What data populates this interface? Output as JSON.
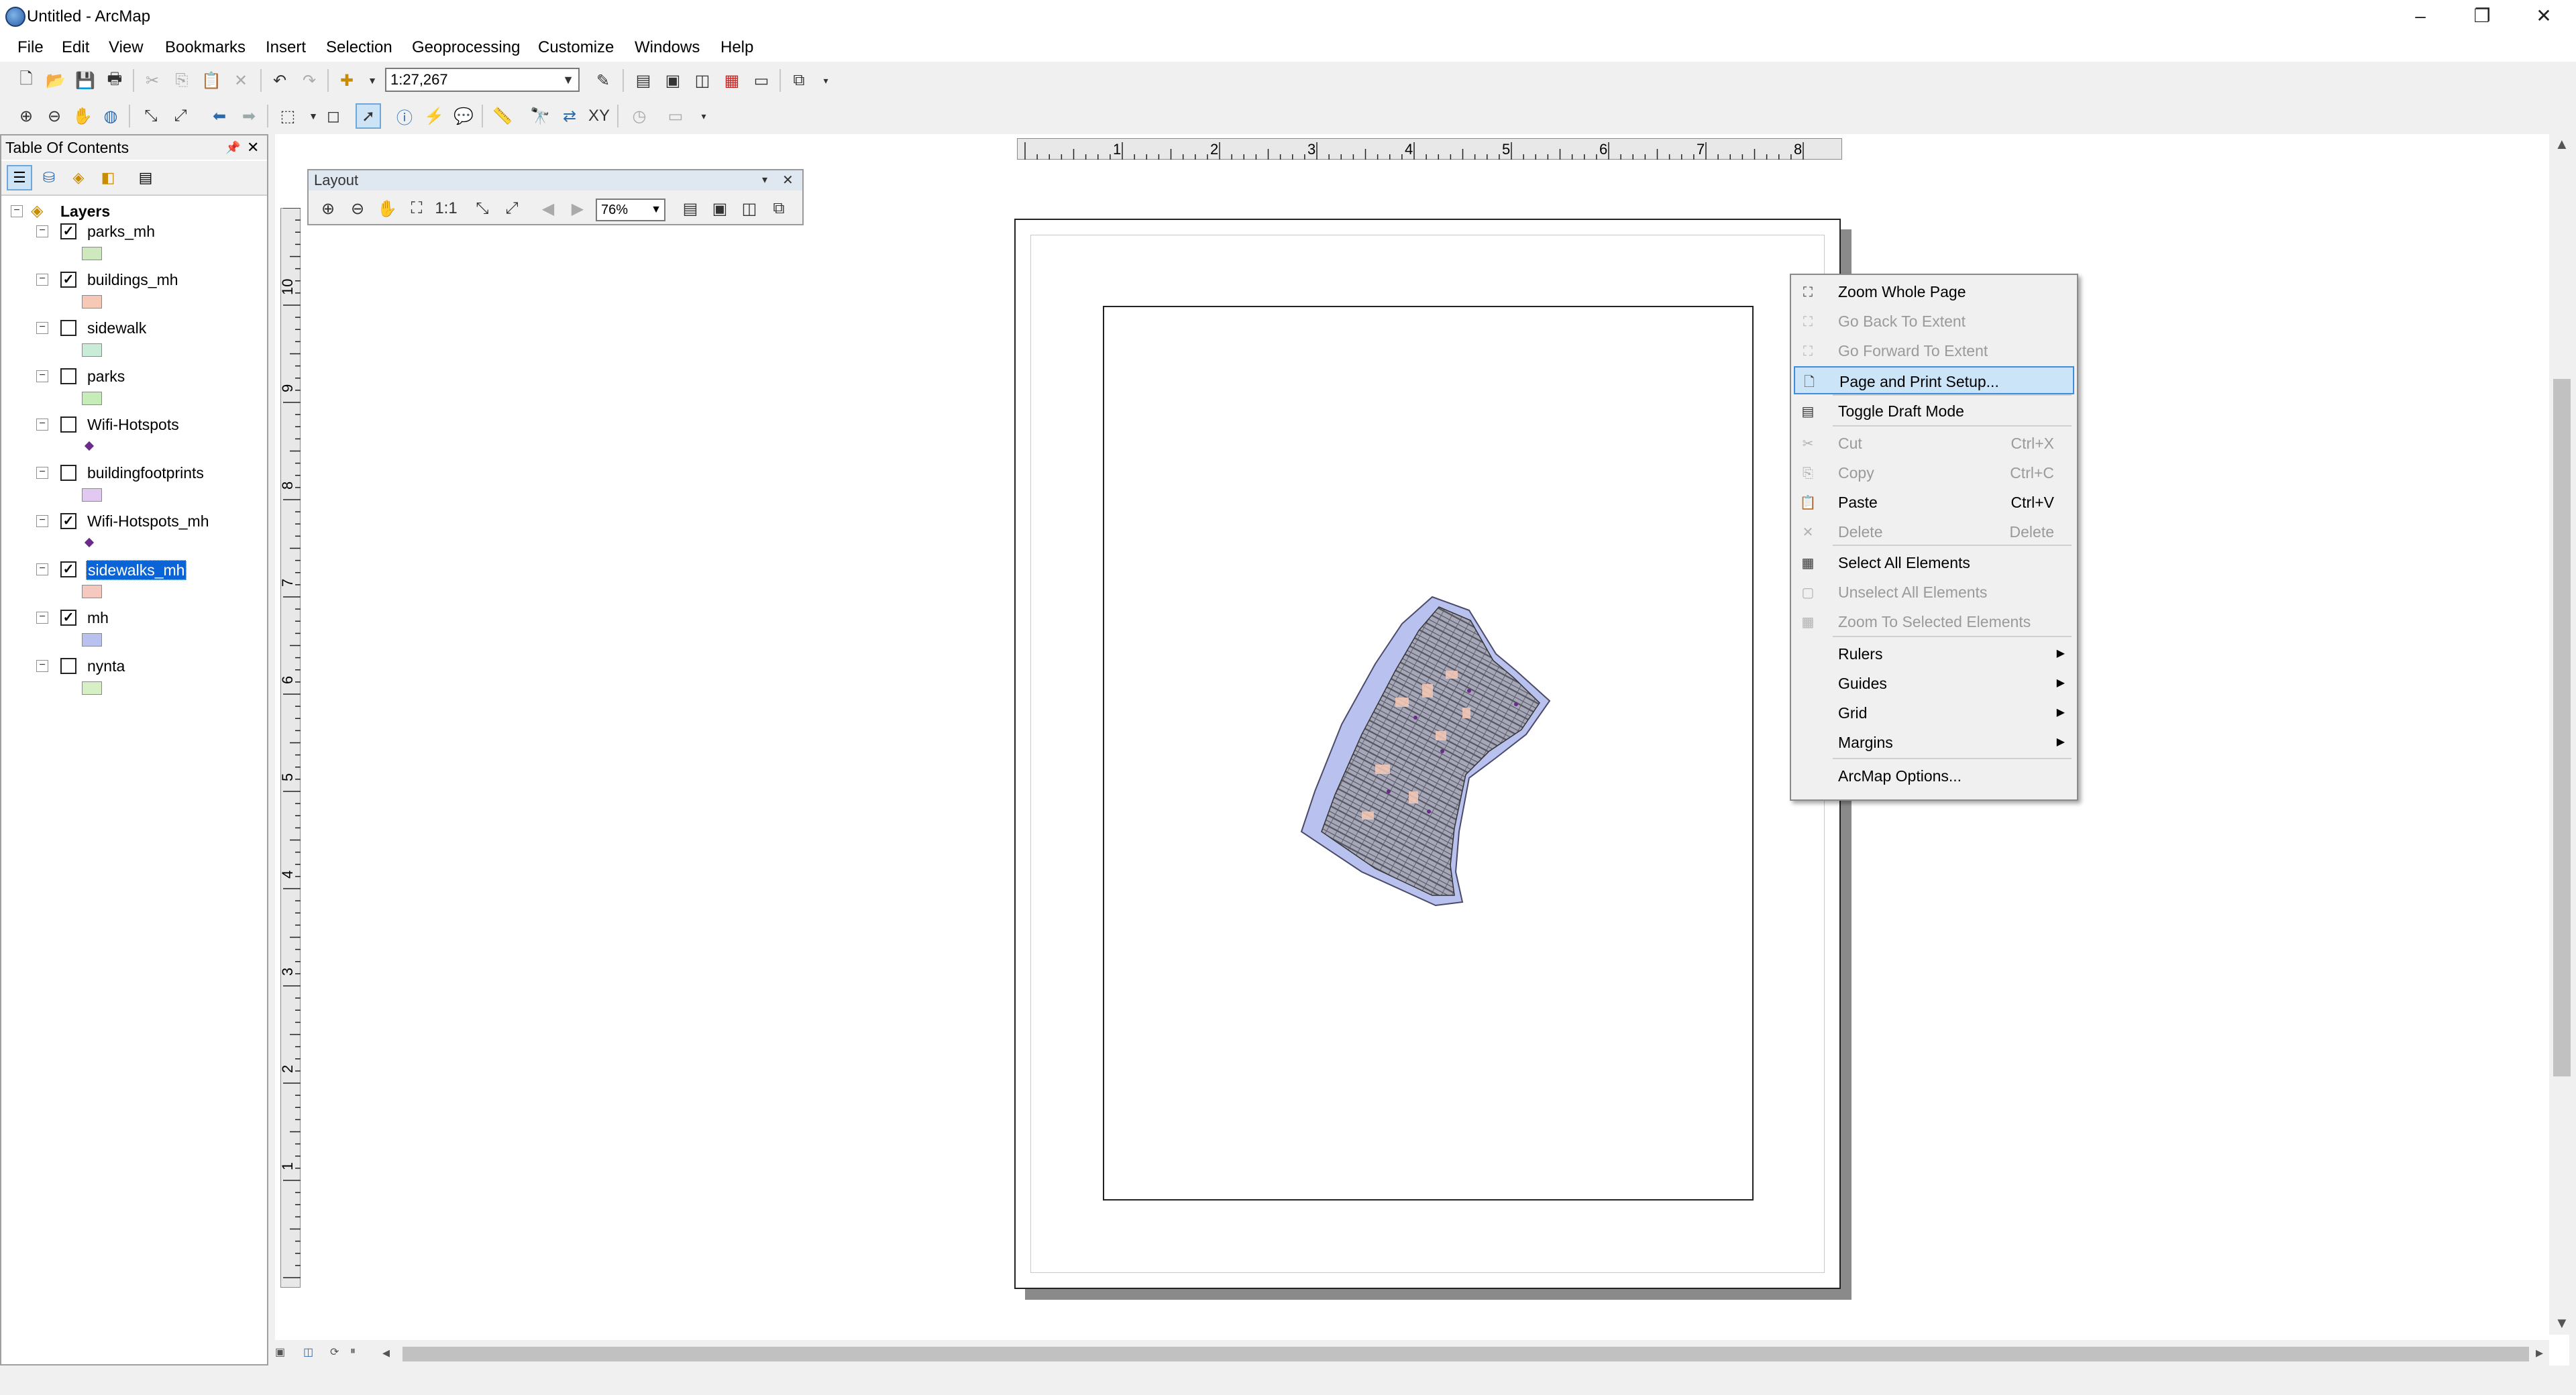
{
  "window": {
    "title": "Untitled - ArcMap",
    "minimize_glyph": "–",
    "restore_glyph": "❐",
    "close_glyph": "✕"
  },
  "menu": [
    "File",
    "Edit",
    "View",
    "Bookmarks",
    "Insert",
    "Selection",
    "Geoprocessing",
    "Customize",
    "Windows",
    "Help"
  ],
  "toolbar": {
    "scale": "1:27,267"
  },
  "toc": {
    "title": "Table Of Contents",
    "pin_glyph": "📌",
    "close_glyph": "✕",
    "root": "Layers",
    "layers": [
      {
        "name": "parks_mh",
        "checked": true,
        "symbol": "#cfe9bf",
        "kind": "poly"
      },
      {
        "name": "buildings_mh",
        "checked": true,
        "symbol": "#f6c9b6",
        "kind": "poly"
      },
      {
        "name": "sidewalk",
        "checked": false,
        "symbol": "#c9ecd9",
        "kind": "poly"
      },
      {
        "name": "parks",
        "checked": false,
        "symbol": "#c6ecb8",
        "kind": "poly"
      },
      {
        "name": "Wifi-Hotspots",
        "checked": false,
        "symbol": "#6b2b8a",
        "kind": "point"
      },
      {
        "name": "buildingfootprints",
        "checked": false,
        "symbol": "#e2c9f2",
        "kind": "poly"
      },
      {
        "name": "Wifi-Hotspots_mh",
        "checked": true,
        "symbol": "#6b2b8a",
        "kind": "point"
      },
      {
        "name": "sidewalks_mh",
        "checked": true,
        "symbol": "#f6c9c0",
        "kind": "poly",
        "selected": true
      },
      {
        "name": "mh",
        "checked": true,
        "symbol": "#b9c2ef",
        "kind": "poly"
      },
      {
        "name": "nynta",
        "checked": false,
        "symbol": "#d7efc4",
        "kind": "poly"
      }
    ]
  },
  "layout_toolbar": {
    "title": "Layout",
    "zoom": "76%"
  },
  "ruler": {
    "h_labels": [
      "1",
      "2",
      "3",
      "4",
      "5",
      "6",
      "7",
      "8"
    ],
    "v_labels": [
      "10",
      "9",
      "8",
      "7",
      "6",
      "5",
      "4",
      "3",
      "2",
      "1"
    ]
  },
  "context_menu": [
    {
      "label": "Zoom Whole Page",
      "icon": "zoom-whole-page-icon",
      "glyph": "⛶",
      "enabled": true
    },
    {
      "label": "Go Back To Extent",
      "icon": "go-back-icon",
      "glyph": "⛶",
      "enabled": false
    },
    {
      "label": "Go Forward To Extent",
      "icon": "go-forward-icon",
      "glyph": "⛶",
      "enabled": false
    },
    {
      "label": "Page and Print Setup...",
      "icon": "page-setup-icon",
      "glyph": "🗋",
      "enabled": true,
      "highlighted": true
    },
    {
      "label": "Toggle Draft Mode",
      "icon": "draft-mode-icon",
      "glyph": "▤",
      "enabled": true
    },
    {
      "label": "Cut",
      "shortcut": "Ctrl+X",
      "icon": "cut-icon",
      "glyph": "✂",
      "enabled": false
    },
    {
      "label": "Copy",
      "shortcut": "Ctrl+C",
      "icon": "copy-icon",
      "glyph": "⎘",
      "enabled": false
    },
    {
      "label": "Paste",
      "shortcut": "Ctrl+V",
      "icon": "paste-icon",
      "glyph": "📋",
      "enabled": true
    },
    {
      "label": "Delete",
      "shortcut": "Delete",
      "icon": "delete-icon",
      "glyph": "✕",
      "enabled": false
    },
    {
      "label": "Select All Elements",
      "icon": "select-all-icon",
      "glyph": "▦",
      "enabled": true
    },
    {
      "label": "Unselect All Elements",
      "icon": "unselect-all-icon",
      "glyph": "▢",
      "enabled": false
    },
    {
      "label": "Zoom To Selected Elements",
      "icon": "zoom-selected-icon",
      "glyph": "▦",
      "enabled": false
    },
    {
      "label": "Rulers",
      "submenu": true,
      "enabled": true
    },
    {
      "label": "Guides",
      "submenu": true,
      "enabled": true
    },
    {
      "label": "Grid",
      "submenu": true,
      "enabled": true
    },
    {
      "label": "Margins",
      "submenu": true,
      "enabled": true
    },
    {
      "label": "ArcMap Options...",
      "enabled": true
    }
  ]
}
